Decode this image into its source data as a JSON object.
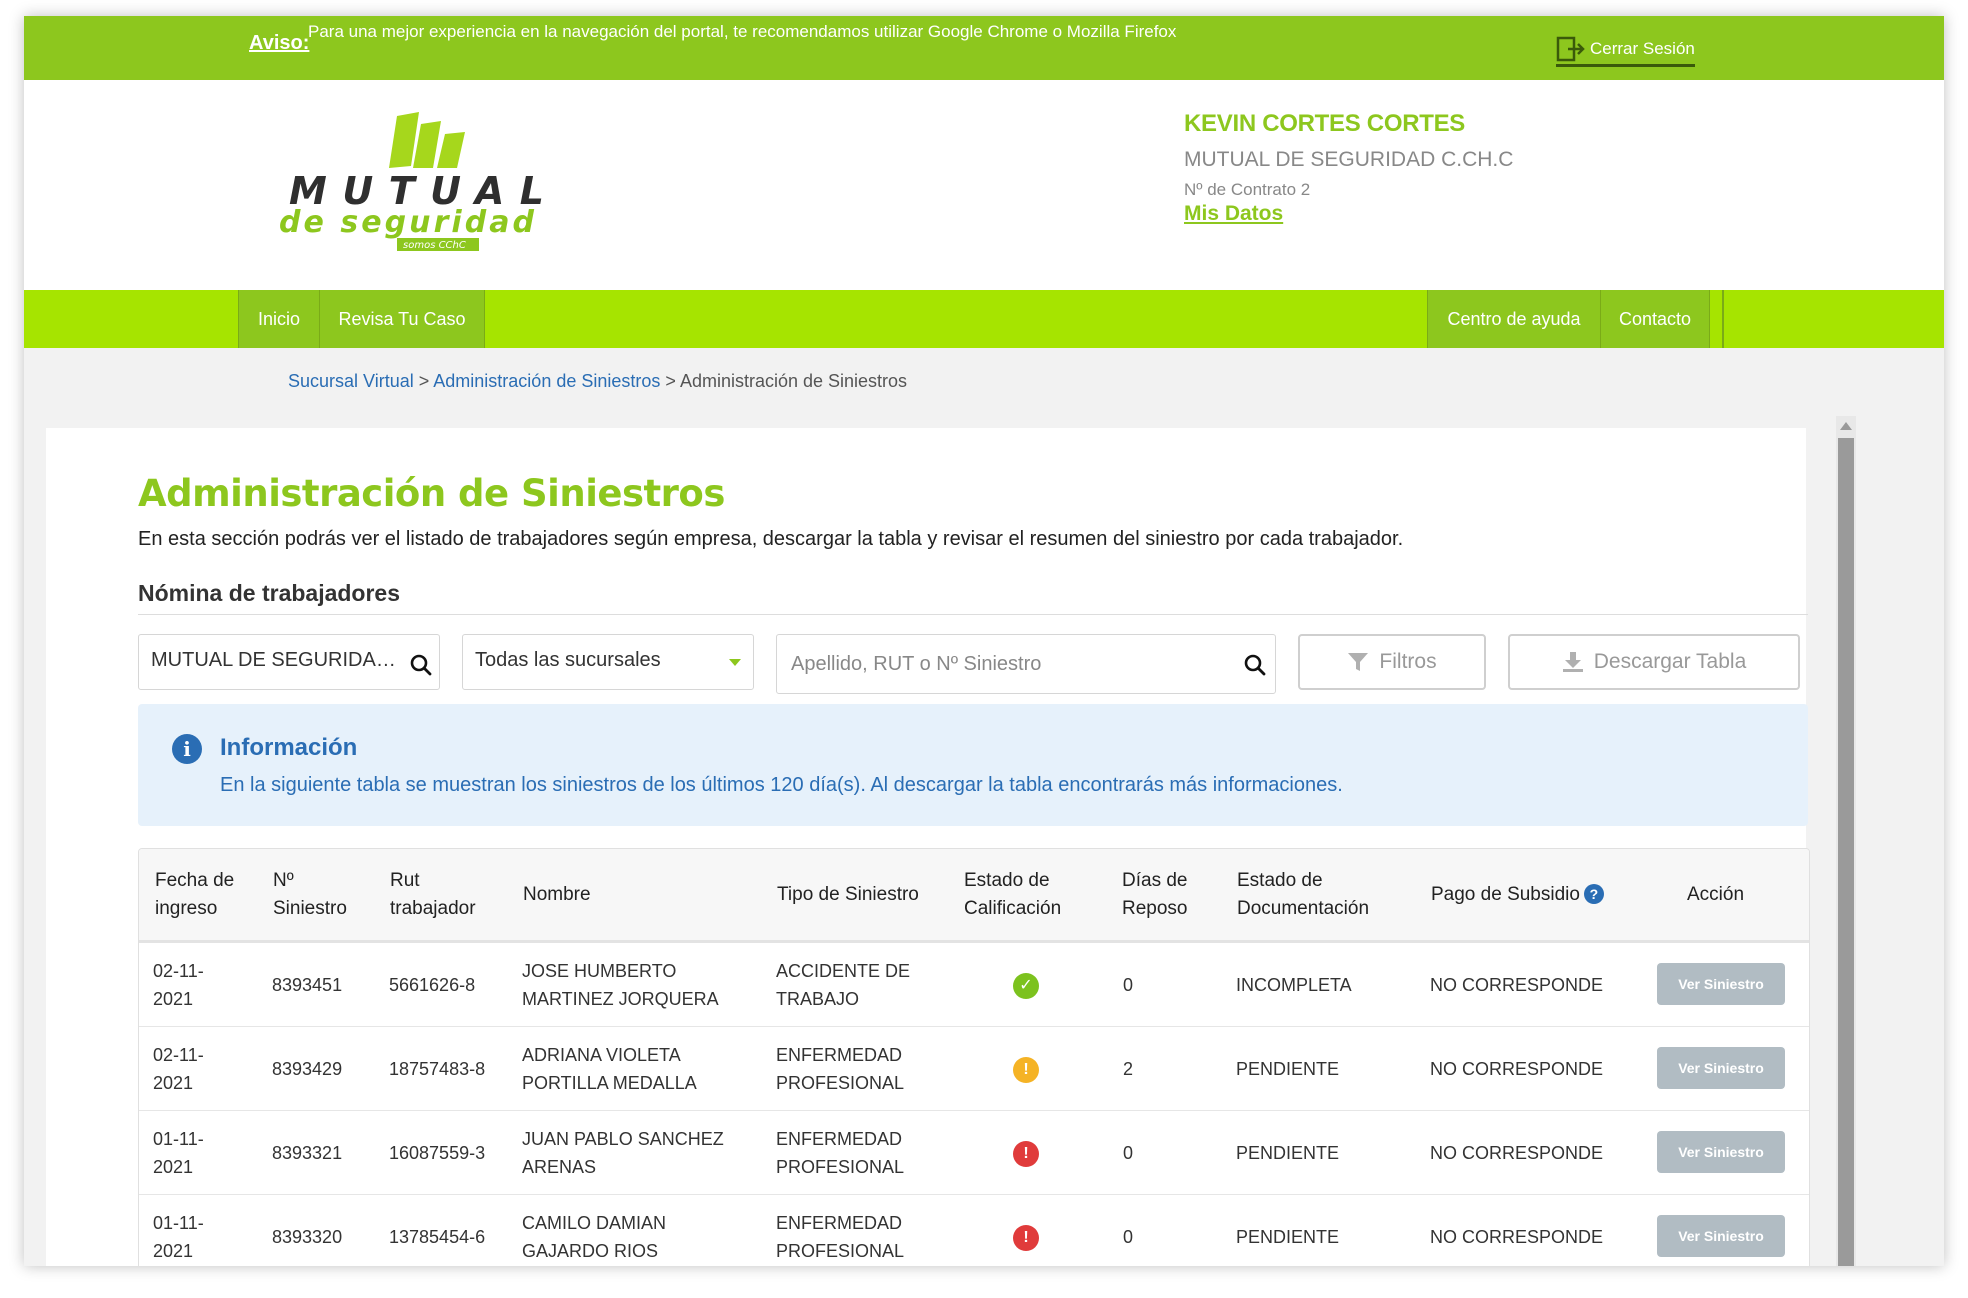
{
  "notice": {
    "label": "Aviso:",
    "text": "Para una mejor experiencia en la navegación del portal, te recomendamos utilizar Google Chrome o Mozilla Firefox",
    "logout_label": "Cerrar Sesión"
  },
  "brand": {
    "logo_line1": "MUTUAL",
    "logo_line2": "de seguridad",
    "logo_line3": "somos CChC",
    "accent_color": "#8dc71e",
    "nav_color": "#a6e400",
    "link_color": "#2a6db4"
  },
  "user": {
    "name": "KEVIN CORTES CORTES",
    "company": "MUTUAL DE SEGURIDAD C.CH.C",
    "contract": "Nº de Contrato 2",
    "my_data_link": "Mis Datos"
  },
  "nav": {
    "left": [
      {
        "label": "Inicio"
      },
      {
        "label": "Revisa Tu Caso"
      }
    ],
    "right": [
      {
        "label": "Centro de ayuda"
      },
      {
        "label": "Contacto"
      }
    ]
  },
  "breadcrumb": {
    "items": [
      "Sucursal Virtual",
      "Administración de Siniestros",
      "Administración de Siniestros"
    ],
    "separator": ">"
  },
  "main": {
    "title": "Administración de Siniestros",
    "description": "En esta sección podrás ver el listado de trabajadores según empresa, descargar la tabla y revisar el resumen del siniestro por cada trabajador.",
    "section_title": "Nómina de trabajadores"
  },
  "filters": {
    "company_value": "MUTUAL DE SEGURIDAD C.CH.C",
    "branch_value": "Todas las sucursales",
    "search_placeholder": "Apellido, RUT o Nº Siniestro",
    "filter_button": "Filtros",
    "download_button": "Descargar Tabla"
  },
  "info": {
    "icon": "info-icon",
    "title": "Información",
    "text": "En la siguiente tabla se muestran los siniestros de los últimos 120 día(s). Al descargar la tabla encontrarás más informaciones."
  },
  "table": {
    "headers": {
      "fecha": [
        "Fecha de",
        "ingreso"
      ],
      "siniestro": [
        "Nº",
        "Siniestro"
      ],
      "rut": [
        "Rut",
        "trabajador"
      ],
      "nombre": "Nombre",
      "tipo": "Tipo de Siniestro",
      "calificacion": [
        "Estado de",
        "Calificación"
      ],
      "reposo": [
        "Días de",
        "Reposo"
      ],
      "documentacion": [
        "Estado de",
        "Documentación"
      ],
      "subsidio": "Pago de Subsidio",
      "accion": "Acción"
    },
    "rows": [
      {
        "fecha": [
          "02-11-",
          "2021"
        ],
        "siniestro": "8393451",
        "rut": "5661626-8",
        "nombre": [
          "JOSE HUMBERTO",
          "MARTINEZ JORQUERA"
        ],
        "tipo": [
          "ACCIDENTE DE",
          "TRABAJO"
        ],
        "calificacion": "check-icon",
        "calificacion_color": "#7cc21e",
        "reposo": "0",
        "documentacion": "INCOMPLETA",
        "subsidio": "NO CORRESPONDE",
        "accion": "Ver Siniestro"
      },
      {
        "fecha": [
          "02-11-",
          "2021"
        ],
        "siniestro": "8393429",
        "rut": "18757483-8",
        "nombre": [
          "ADRIANA VIOLETA",
          "PORTILLA MEDALLA"
        ],
        "tipo": [
          "ENFERMEDAD",
          "PROFESIONAL"
        ],
        "calificacion": "warning-icon",
        "calificacion_color": "#f5b325",
        "reposo": "2",
        "documentacion": "PENDIENTE",
        "subsidio": "NO CORRESPONDE",
        "accion": "Ver Siniestro"
      },
      {
        "fecha": [
          "01-11-",
          "2021"
        ],
        "siniestro": "8393321",
        "rut": "16087559-3",
        "nombre": [
          "JUAN PABLO SANCHEZ",
          "ARENAS"
        ],
        "tipo": [
          "ENFERMEDAD",
          "PROFESIONAL"
        ],
        "calificacion": "error-icon",
        "calificacion_color": "#e03b3b",
        "reposo": "0",
        "documentacion": "PENDIENTE",
        "subsidio": "NO CORRESPONDE",
        "accion": "Ver Siniestro"
      },
      {
        "fecha": [
          "01-11-",
          "2021"
        ],
        "siniestro": "8393320",
        "rut": "13785454-6",
        "nombre": [
          "CAMILO DAMIAN",
          "GAJARDO RIOS"
        ],
        "tipo": [
          "ENFERMEDAD",
          "PROFESIONAL"
        ],
        "calificacion": "error-icon",
        "calificacion_color": "#e03b3b",
        "reposo": "0",
        "documentacion": "PENDIENTE",
        "subsidio": "NO CORRESPONDE",
        "accion": "Ver Siniestro"
      }
    ]
  }
}
